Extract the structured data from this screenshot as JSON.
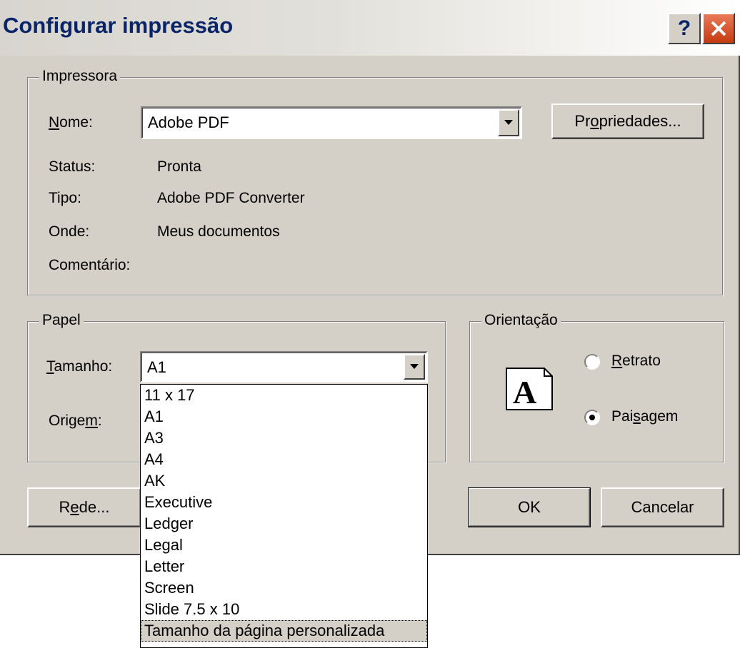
{
  "window": {
    "title": "Configurar impressão"
  },
  "titlebar": {
    "help_label": "?"
  },
  "printer": {
    "group_label": "Impressora",
    "name_label_accel": "N",
    "name_label_rest": "ome:",
    "name_value": "Adobe PDF",
    "properties_pre": "Pr",
    "properties_accel": "o",
    "properties_post": "priedades...",
    "status_label": "Status:",
    "status_value": "Pronta",
    "type_label": "Tipo:",
    "type_value": "Adobe PDF Converter",
    "where_label": "Onde:",
    "where_value": "Meus documentos",
    "comment_label": "Comentário:"
  },
  "paper": {
    "group_label": "Papel",
    "size_label_accel": "T",
    "size_label_rest": "amanho:",
    "size_value": "A1",
    "source_label_pre": "Orige",
    "source_label_accel": "m",
    "source_label_post": ":",
    "size_options": [
      "11 x 17",
      "A1",
      "A3",
      "A4",
      "AK",
      "Executive",
      "Ledger",
      "Legal",
      "Letter",
      "Screen",
      "Slide 7.5 x 10",
      "Tamanho da página personalizada"
    ],
    "highlighted_option": "Tamanho da página personalizada"
  },
  "orientation": {
    "group_label": "Orientação",
    "icon_letter": "A",
    "portrait_accel": "R",
    "portrait_rest": "etrato",
    "landscape_pre": "Pai",
    "landscape_accel": "s",
    "landscape_post": "agem",
    "selected": "landscape"
  },
  "buttons": {
    "network_pre": "R",
    "network_accel": "e",
    "network_post": "de...",
    "ok": "OK",
    "cancel": "Cancelar"
  },
  "colors": {
    "face": "#d4d0c8",
    "title_text": "#0a246a",
    "close_red": "#c43b12"
  }
}
